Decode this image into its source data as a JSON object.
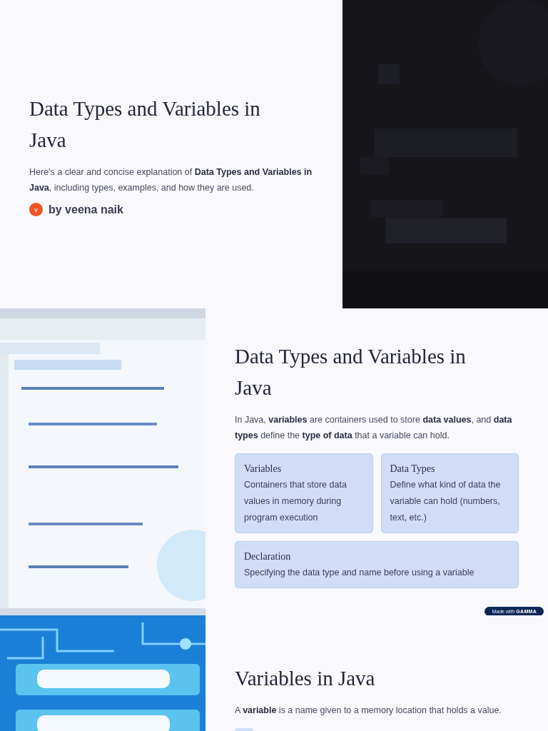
{
  "cover": {
    "title": "Data Types and Variables in Java",
    "intro": "Here's a clear and concise explanation of **Data Types and Variables in Java**, including types, examples, and how they are used.",
    "author": {
      "initial": "v",
      "name": "by veena naik"
    }
  },
  "overview": {
    "title": "Data Types and Variables in Java",
    "intro": "In Java, **variables** are containers used to store **data values**, and **data types** define the **type of data** that a variable can hold.",
    "cards": [
      {
        "title": "Variables",
        "text": "Containers that store data values in memory during program execution"
      },
      {
        "title": "Data Types",
        "text": "Define what kind of data the variable can hold (numbers, text, etc.)"
      },
      {
        "title": "Declaration",
        "text": "Specifying the data type and name before using a variable"
      }
    ],
    "badge": "Made with **GAMMA**"
  },
  "variables": {
    "title": "Variables in Java",
    "intro": "A **variable** is a name given to a memory location that holds a value."
  }
}
